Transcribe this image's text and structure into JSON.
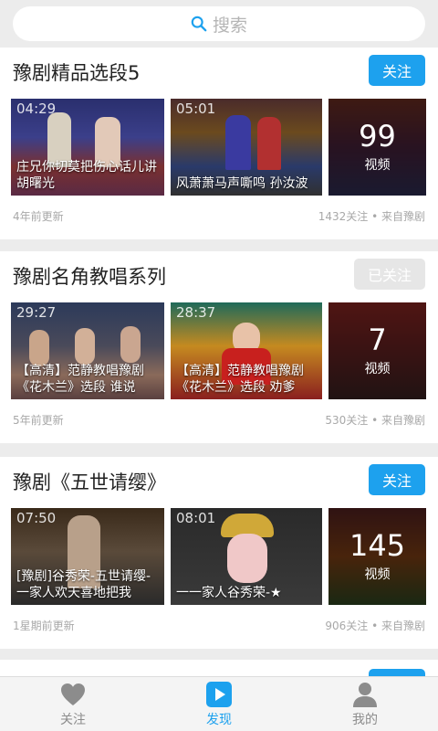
{
  "search": {
    "placeholder": "搜索",
    "icon": "search-icon"
  },
  "colors": {
    "accent": "#1da1ee",
    "followed": "#e6e6e6"
  },
  "cards": [
    {
      "title": "豫剧精品选段5",
      "follow_label": "关注",
      "followed": false,
      "videos": [
        {
          "duration": "04:29",
          "caption": "庄兄你切莫把伤心话儿讲 胡曙光"
        },
        {
          "duration": "05:01",
          "caption": "风萧萧马声嘶鸣 孙汝波"
        }
      ],
      "more": {
        "count": "99",
        "unit": "视频"
      },
      "updated": "4年前更新",
      "stats": "1432关注 • 来自豫剧"
    },
    {
      "title": "豫剧名角教唱系列",
      "follow_label": "已关注",
      "followed": true,
      "videos": [
        {
          "duration": "29:27",
          "caption": "【高清】范静教唱豫剧《花木兰》选段 谁说"
        },
        {
          "duration": "28:37",
          "caption": "【高清】范静教唱豫剧《花木兰》选段 劝爹"
        }
      ],
      "more": {
        "count": "7",
        "unit": "视频"
      },
      "updated": "5年前更新",
      "stats": "530关注 • 来自豫剧"
    },
    {
      "title": "豫剧《五世请缨》",
      "follow_label": "关注",
      "followed": false,
      "videos": [
        {
          "duration": "07:50",
          "caption": "[豫剧]谷秀荣-五世请缨-一家人欢天喜地把我"
        },
        {
          "duration": "08:01",
          "caption": "一一家人谷秀荣-★"
        }
      ],
      "more": {
        "count": "145",
        "unit": "视频"
      },
      "updated": "1星期前更新",
      "stats": "906关注 • 来自豫剧"
    }
  ],
  "tabbar": [
    {
      "label": "关注",
      "icon": "heart-icon",
      "active": false
    },
    {
      "label": "发现",
      "icon": "play-icon",
      "active": true
    },
    {
      "label": "我的",
      "icon": "person-icon",
      "active": false
    }
  ]
}
